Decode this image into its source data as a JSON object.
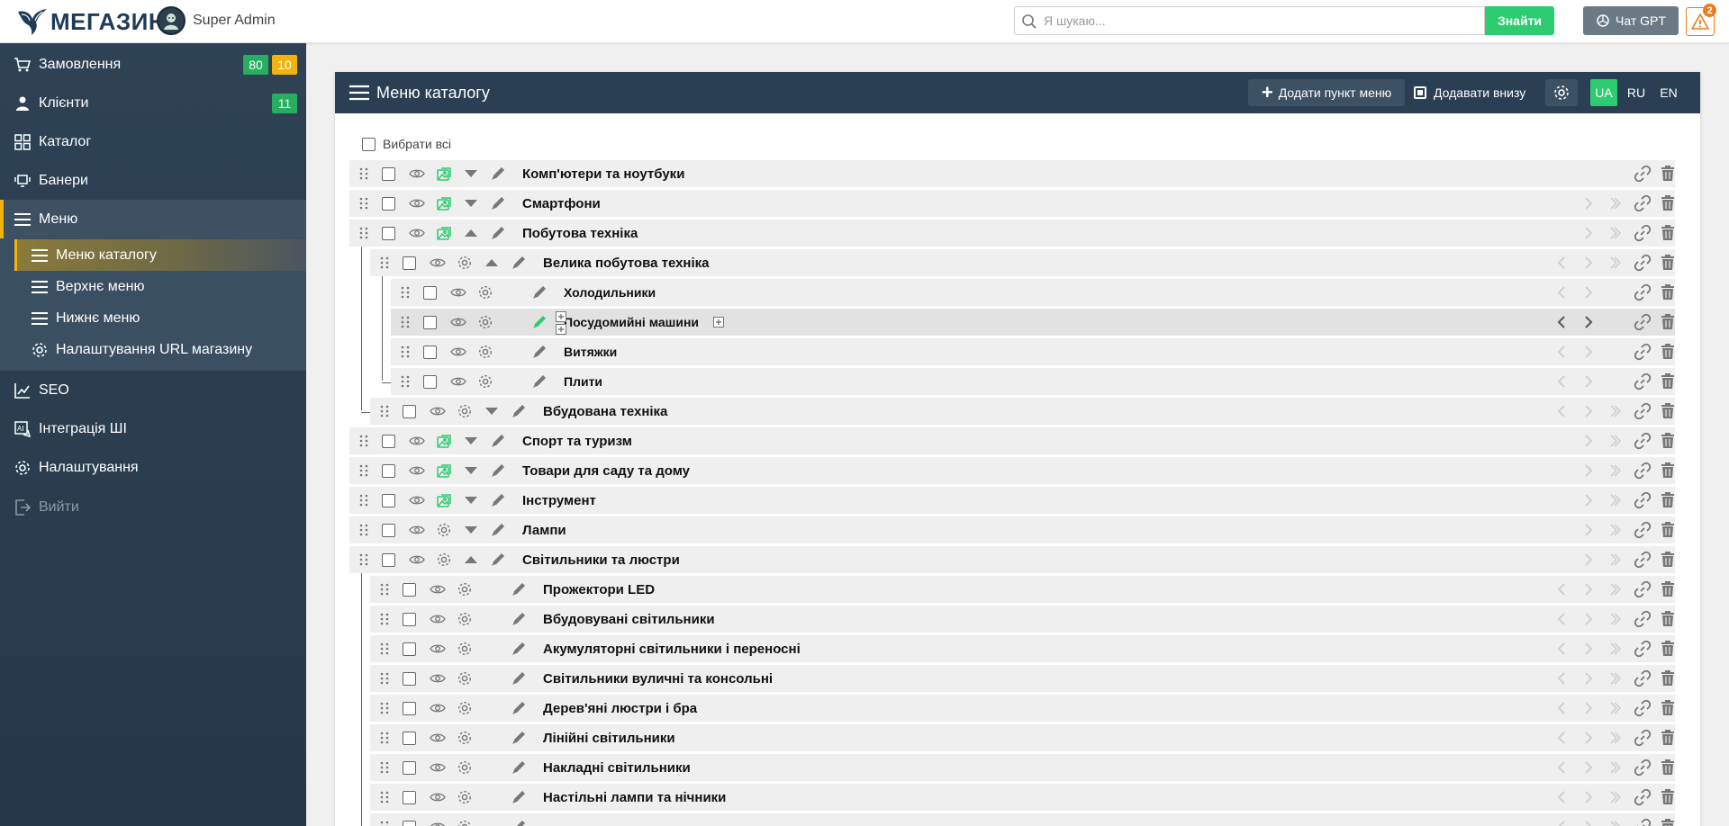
{
  "topbar": {
    "logo_text": "МЕГАЗИН",
    "admin_name": "Super Admin",
    "search_placeholder": "Я шукаю...",
    "search_button": "Знайти",
    "chat_button": "Чат GPT",
    "alert_count": "2"
  },
  "sidebar": {
    "items": [
      {
        "label": "Замовлення",
        "icon": "cart-icon",
        "badges": [
          "80",
          "10"
        ]
      },
      {
        "label": "Клієнти",
        "icon": "clients-icon",
        "badges": [
          "11"
        ]
      },
      {
        "label": "Каталог",
        "icon": "grid-icon"
      },
      {
        "label": "Банери",
        "icon": "banner-icon"
      },
      {
        "label": "Меню",
        "icon": "menu-icon"
      },
      {
        "label": "SEO",
        "icon": "chart-line-icon"
      },
      {
        "label": "Інтеграція ШІ",
        "icon": "ai-icon"
      },
      {
        "label": "Налаштування",
        "icon": "gear-icon"
      },
      {
        "label": "Вийти",
        "icon": "logout-icon"
      }
    ],
    "submenu": [
      {
        "label": "Меню каталогу",
        "icon": "menu-icon"
      },
      {
        "label": "Верхнє меню",
        "icon": "menu-icon"
      },
      {
        "label": "Нижнє меню",
        "icon": "menu-icon"
      },
      {
        "label": "Налаштування URL магазину",
        "icon": "gear-icon"
      }
    ]
  },
  "panel": {
    "title": "Меню каталогу",
    "add_button": "Додати пункт меню",
    "add_bottom": "Додавати внизу",
    "languages": [
      "UA",
      "RU",
      "EN"
    ],
    "active_language": "UA",
    "select_all": "Вибрати всі"
  },
  "rows": [
    {
      "label": "Комп'ютери та ноутбуки",
      "level": 0,
      "img": true,
      "toggle": "down"
    },
    {
      "label": "Смартфони",
      "level": 0,
      "img": true,
      "toggle": "down"
    },
    {
      "label": "Побутова техніка",
      "level": 0,
      "img": true,
      "toggle": "up"
    },
    {
      "label": "Велика побутова техніка",
      "level": 1,
      "toggle": "up"
    },
    {
      "label": "Холодильники",
      "level": 2
    },
    {
      "label": "Посудомийні машини",
      "level": 2,
      "highlight": true
    },
    {
      "label": "Витяжки",
      "level": 2
    },
    {
      "label": "Плити",
      "level": 2
    },
    {
      "label": "Вбудована техніка",
      "level": 1,
      "toggle": "down"
    },
    {
      "label": "Спорт та туризм",
      "level": 0,
      "img": true,
      "toggle": "down"
    },
    {
      "label": "Товари для саду та дому",
      "level": 0,
      "img": true,
      "toggle": "down"
    },
    {
      "label": "Інструмент",
      "level": 0,
      "img": true,
      "toggle": "down"
    },
    {
      "label": "Лампи",
      "level": 0,
      "toggle": "down"
    },
    {
      "label": "Світильники та люстри",
      "level": 0,
      "toggle": "up"
    },
    {
      "label": "Прожектори LED",
      "level": 1
    },
    {
      "label": "Вбудовувані світильники",
      "level": 1
    },
    {
      "label": "Акумуляторні світильники і переносні",
      "level": 1
    },
    {
      "label": "Світильники вуличні та консольні",
      "level": 1
    },
    {
      "label": "Дерев'яні люстри і бра",
      "level": 1
    },
    {
      "label": "Лінійні світильники",
      "level": 1
    },
    {
      "label": "Накладні світильники",
      "level": 1
    },
    {
      "label": "Настільні лампи та нічники",
      "level": 1
    },
    {
      "label": "",
      "level": 1
    }
  ],
  "colors": {
    "accent_green": "#2ecc71",
    "header_dark": "#2a3f53",
    "badge_yellow": "#f1b40f",
    "alert_orange": "#e67e22"
  }
}
